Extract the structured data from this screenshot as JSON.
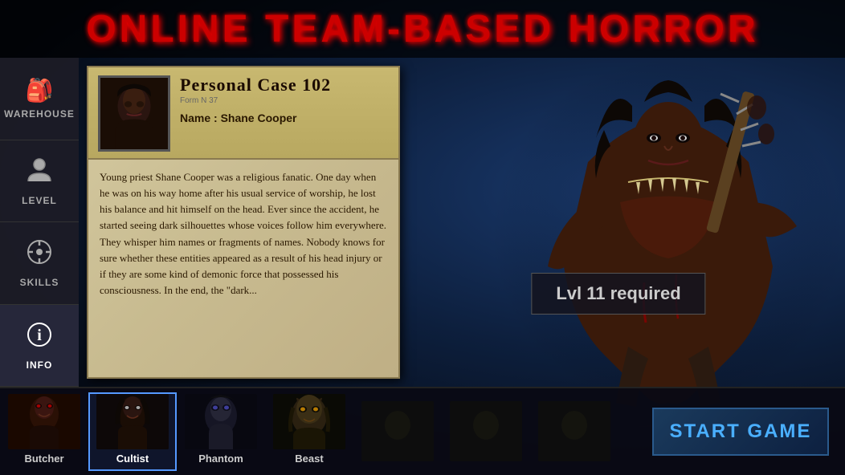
{
  "app": {
    "title": "ONLINE TEAM-BASED HORROR"
  },
  "sidebar": {
    "items": [
      {
        "id": "warehouse",
        "label": "Warehouse",
        "icon": "🎒",
        "active": false
      },
      {
        "id": "level",
        "label": "Level",
        "icon": "👤",
        "active": false
      },
      {
        "id": "skills",
        "label": "Skills",
        "icon": "⚙️",
        "active": false
      },
      {
        "id": "info",
        "label": "Info",
        "icon": "ℹ",
        "active": true
      }
    ]
  },
  "case_file": {
    "title": "Personal Case 102",
    "form_number": "Form N 37",
    "name_label": "Name : Shane Cooper",
    "description": "Young priest Shane Cooper was a religious fanatic. One day when he was on his way home after his usual service of worship, he lost his balance and hit himself on the head. Ever since the accident, he started seeing dark silhouettes whose voices follow him everywhere. They whisper him names or fragments of names. Nobody knows for sure whether these entities appeared as a result of his head injury or if they are some kind of demonic force that possessed his consciousness. In the end, the \"dark..."
  },
  "monster": {
    "level_required": "Lvl 11 required"
  },
  "characters": [
    {
      "id": "butcher",
      "label": "Butcher",
      "active": false
    },
    {
      "id": "cultist",
      "label": "Cultist",
      "active": true
    },
    {
      "id": "phantom",
      "label": "Phantom",
      "active": false
    },
    {
      "id": "beast",
      "label": "Beast",
      "active": false
    },
    {
      "id": "slot5",
      "label": "",
      "active": false
    },
    {
      "id": "slot6",
      "label": "",
      "active": false
    },
    {
      "id": "slot7",
      "label": "",
      "active": false
    }
  ],
  "buttons": {
    "start_game": "START GAME"
  }
}
